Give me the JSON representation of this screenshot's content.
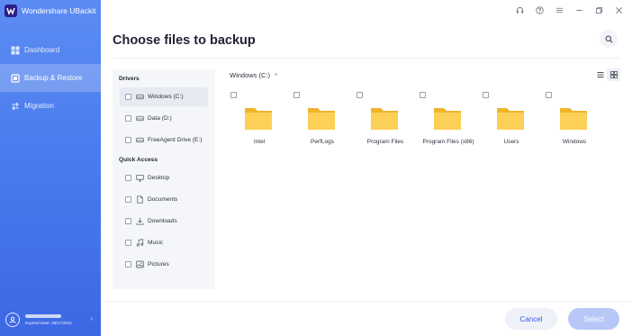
{
  "app": {
    "title": "Wondershare UBackit",
    "brand_color": "#4a7bef"
  },
  "sidebar": {
    "items": [
      {
        "label": "Dashboard",
        "icon": "dashboard-icon",
        "active": false
      },
      {
        "label": "Backup & Restore",
        "icon": "backup-icon",
        "active": true
      },
      {
        "label": "Migration",
        "icon": "migration-icon",
        "active": false
      }
    ],
    "account": {
      "expire_text": "Expired Date: 08/17/2021"
    }
  },
  "window_controls": [
    "headset-icon",
    "help-icon",
    "menu-icon",
    "minimize-icon",
    "restore-icon",
    "close-icon"
  ],
  "page": {
    "title": "Choose files to backup"
  },
  "left_panel": {
    "drivers_heading": "Drivers",
    "drivers": [
      {
        "label": "Windows (C:)",
        "icon": "drive-icon",
        "selected": true
      },
      {
        "label": "Data (D:)",
        "icon": "drive-icon",
        "selected": false
      },
      {
        "label": "FreeAgent Drive (E:)",
        "icon": "drive-icon",
        "selected": false
      }
    ],
    "quick_access_heading": "Quick Access",
    "quick_access": [
      {
        "label": "Desktop",
        "icon": "desktop-icon"
      },
      {
        "label": "Documents",
        "icon": "document-icon"
      },
      {
        "label": "Downloads",
        "icon": "download-icon"
      },
      {
        "label": "Music",
        "icon": "music-icon"
      },
      {
        "label": "Pictures",
        "icon": "picture-icon"
      }
    ]
  },
  "content": {
    "path": "Windows (C:)",
    "view_mode": "grid",
    "folders": [
      {
        "name": "Intel"
      },
      {
        "name": "PerfLogs"
      },
      {
        "name": "Program Files"
      },
      {
        "name": "Program Files (x86)"
      },
      {
        "name": "Users"
      },
      {
        "name": "Windows"
      }
    ]
  },
  "footer": {
    "cancel_label": "Cancel",
    "select_label": "Select"
  }
}
